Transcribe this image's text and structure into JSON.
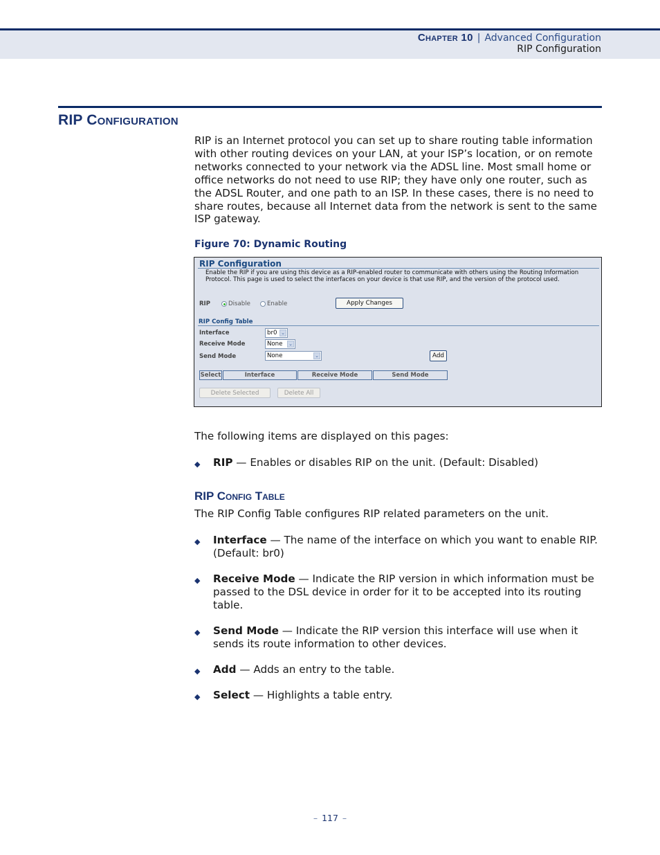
{
  "header": {
    "chapter": "Chapter 10",
    "separator": "|",
    "chapter_title": "Advanced Configuration",
    "section": "RIP Configuration"
  },
  "section": {
    "title": "RIP Configuration",
    "intro": "RIP is an Internet protocol you can set up to share routing table information with other routing devices on your LAN, at your ISP’s location, or on remote networks connected to your network via the ADSL line. Most small home or office networks do not need to use RIP; they have only one router, such as the ADSL Router, and one path to an ISP. In these cases, there is no need to share routes, because all Internet data from the network is sent to the same ISP gateway."
  },
  "figure": {
    "caption": "Figure 70:  Dynamic Routing",
    "ui": {
      "title": "RIP Configuration",
      "description": "Enable the RIP if you are using this device as a RIP-enabled router to communicate with others using the Routing Information Protocol. This page is used to select the interfaces on your device is that use RIP, and the version of the protocol used.",
      "rip_label": "RIP",
      "radio_disable": "Disable",
      "radio_enable": "Enable",
      "rip_selected": "Disable",
      "apply_button": "Apply Changes",
      "table_title": "RIP Config Table",
      "interface_label": "Interface",
      "interface_value": "br0",
      "receive_label": "Receive Mode",
      "receive_value": "None",
      "send_label": "Send Mode",
      "send_value": "None",
      "add_button": "Add",
      "columns": [
        "Select",
        "Interface",
        "Receive Mode",
        "Send Mode"
      ],
      "delete_selected_button": "Delete Selected",
      "delete_all_button": "Delete All"
    }
  },
  "items_intro": "The following items are displayed on this pages:",
  "items": [
    {
      "term": "RIP",
      "desc": " — Enables or disables RIP on the unit. (Default: Disabled)"
    }
  ],
  "subsection": {
    "title": "RIP Config Table",
    "intro": "The RIP Config Table configures RIP related parameters on the unit.",
    "items": [
      {
        "term": "Interface",
        "desc": " — The name of the interface on which you want to enable RIP. (Default: br0)"
      },
      {
        "term": "Receive Mode",
        "desc": " — Indicate the RIP version in which information must be passed to the DSL device in order for it to be accepted into its routing table."
      },
      {
        "term": "Send Mode",
        "desc": " — Indicate the RIP version this interface will use when it sends its route information to other devices."
      },
      {
        "term": "Add",
        "desc": " — Adds an entry to the table."
      },
      {
        "term": "Select",
        "desc": " — Highlights a table entry."
      }
    ]
  },
  "footer": {
    "page_number": "117",
    "dash": "–"
  }
}
